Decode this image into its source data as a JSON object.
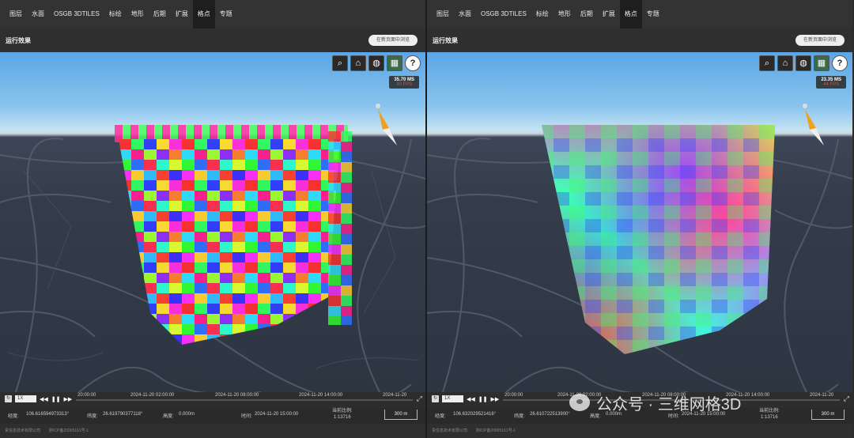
{
  "menu": [
    "图层",
    "水面",
    "OSGB 3DTILES",
    "标绘",
    "地形",
    "后期",
    "扩展",
    "格点",
    "专题"
  ],
  "active_menu": "格点",
  "run_title": "运行效果",
  "open_button": "在新页面中浏览",
  "icons": {
    "search": "search-icon",
    "home": "home-icon",
    "globe": "globe-icon",
    "layers": "layers-icon",
    "help": "help-icon",
    "compass": "compass-icon"
  },
  "left": {
    "ms": "35.70 MS",
    "fps": "30 FPS",
    "speed": "1X",
    "ticks": [
      "20:00:00",
      "2024-11-20 02:00:00",
      "2024-11-20 08:00:00",
      "2024-11-20 14:00:00",
      "2024-11-20"
    ],
    "lon_label": "经度:",
    "lon": "106.616594973313°",
    "lat_label": "纬度:",
    "lat": "26.619790377118°",
    "height_label": "高度:",
    "height": "0.000m",
    "time_label": "时间:",
    "time": "2024-11-20 15:00:00",
    "ratio_label": "当前比例:",
    "ratio": "1:13716",
    "scale": "300 m",
    "company": "贵信息技术有限公司",
    "icp": "黔ICP备20005161号-1"
  },
  "right": {
    "ms": "23.35 MS",
    "fps": "44 FPS",
    "speed": "1X",
    "ticks": [
      "20:00:00",
      "2024-11-20 02:00:00",
      "2024-11-20 08:00:00",
      "2024-11-20 14:00:00",
      "2024-11-20"
    ],
    "lon_label": "经度:",
    "lon": "106.632029521416°",
    "lat_label": "纬度:",
    "lat": "26.610722513900°",
    "height_label": "高度:",
    "height": "0.000m",
    "time_label": "时间:",
    "time": "2024-11-20 15:00:00",
    "ratio_label": "当前比例:",
    "ratio": "1:13716",
    "scale": "300 m",
    "company": "贵信息技术有限公司",
    "icp": "黔ICP备20005161号-1"
  },
  "watermark": "公众号 · 三维网格3D"
}
